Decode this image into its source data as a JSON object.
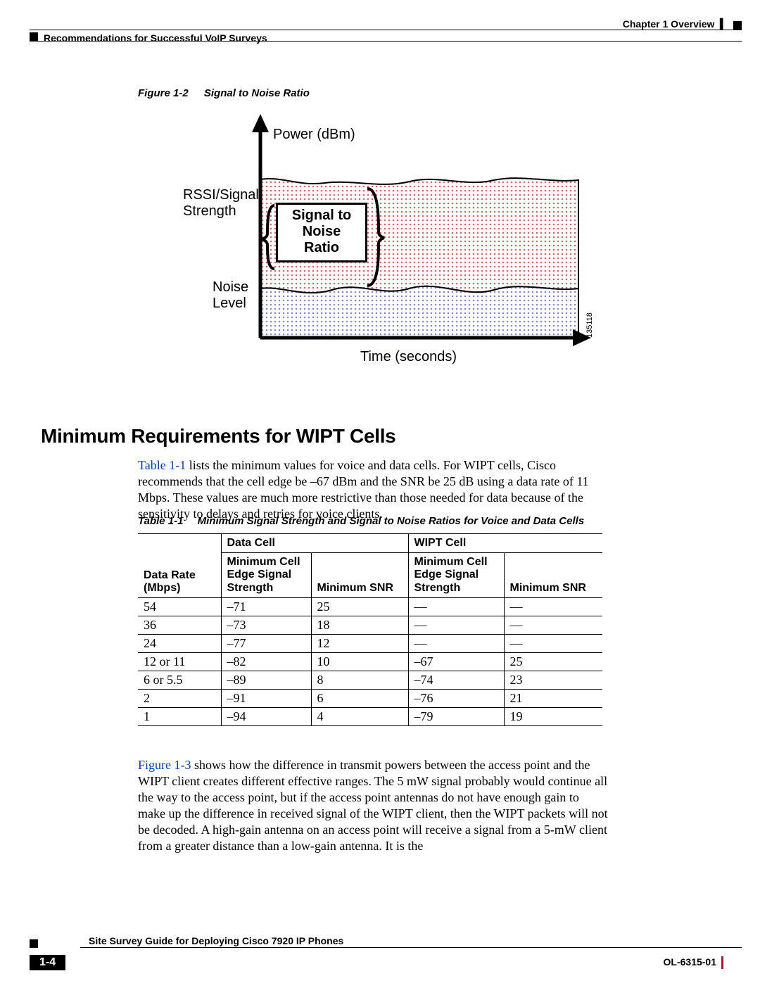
{
  "header": {
    "chapter": "Chapter 1    Overview",
    "section": "Recommendations for Successful VoIP Surveys"
  },
  "figure": {
    "num": "Figure 1-2",
    "title": "Signal to Noise Ratio",
    "labels": {
      "power": "Power (dBm)",
      "rssi_signal": "RSSI/Signal",
      "strength": "Strength",
      "snr1": "Signal to",
      "snr2": "Noise",
      "snr3": "Ratio",
      "noise": "Noise",
      "level": "Level",
      "time": "Time (seconds)",
      "id": "135118"
    }
  },
  "heading": "Minimum Requirements for WIPT Cells",
  "para1_link": "Table 1-1",
  "para1_rest": " lists the minimum values for voice and data cells. For WIPT cells, Cisco recommends that the cell edge be –67 dBm and the SNR be 25 dB using a data rate of 11 Mbps. These values are much more restrictive than those needed for data because of the sensitivity to delays and retries for voice clients.",
  "table_cap": {
    "num": "Table 1-1",
    "title": "Minimum Signal Strength and Signal to Noise Ratios for Voice and Data Cells"
  },
  "table": {
    "groups": {
      "g1": "Data Cell",
      "g2": "WIPT Cell"
    },
    "cols": {
      "c0": "Data Rate (Mbps)",
      "c1a": "Minimum Cell",
      "c1b": "Edge Signal",
      "c1c": "Strength",
      "c2": "Minimum SNR",
      "c3a": "Minimum Cell",
      "c3b": "Edge Signal",
      "c3c": "Strength",
      "c4": "Minimum SNR"
    },
    "rows": [
      {
        "rate": "54",
        "d_edge": "–71",
        "d_snr": "25",
        "w_edge": "—",
        "w_snr": "—"
      },
      {
        "rate": "36",
        "d_edge": "–73",
        "d_snr": "18",
        "w_edge": "—",
        "w_snr": "—"
      },
      {
        "rate": "24",
        "d_edge": "–77",
        "d_snr": "12",
        "w_edge": "—",
        "w_snr": "—"
      },
      {
        "rate": "12 or 11",
        "d_edge": "–82",
        "d_snr": "10",
        "w_edge": "–67",
        "w_snr": "25"
      },
      {
        "rate": "6 or 5.5",
        "d_edge": "–89",
        "d_snr": "8",
        "w_edge": "–74",
        "w_snr": "23"
      },
      {
        "rate": "2",
        "d_edge": "–91",
        "d_snr": "6",
        "w_edge": "–76",
        "w_snr": "21"
      },
      {
        "rate": "1",
        "d_edge": "–94",
        "d_snr": "4",
        "w_edge": "–79",
        "w_snr": "19"
      }
    ]
  },
  "para2_link": "Figure 1-3",
  "para2_rest": " shows how the difference in transmit powers between the access point and the WIPT client creates different effective ranges. The 5 mW signal probably would continue all the way to the access point, but if the access point antennas do not have enough gain to make up the difference in received signal of the WIPT client, then the WIPT packets will not be decoded. A high-gain antenna on an access point will receive a signal from a 5-mW client from a greater distance than a low-gain antenna. It is the",
  "footer": {
    "title": "Site Survey Guide for Deploying Cisco 7920 IP Phones",
    "doc": "OL-6315-01",
    "page": "1-4"
  },
  "chart_data": {
    "type": "table",
    "title": "Minimum Signal Strength and Signal to Noise Ratios for Voice and Data Cells",
    "columns": [
      "Data Rate (Mbps)",
      "Data Cell Minimum Cell Edge Signal Strength",
      "Data Cell Minimum SNR",
      "WIPT Cell Minimum Cell Edge Signal Strength",
      "WIPT Cell Minimum SNR"
    ],
    "rows": [
      [
        "54",
        -71,
        25,
        null,
        null
      ],
      [
        "36",
        -73,
        18,
        null,
        null
      ],
      [
        "24",
        -77,
        12,
        null,
        null
      ],
      [
        "12 or 11",
        -82,
        10,
        -67,
        25
      ],
      [
        "6 or 5.5",
        -89,
        8,
        -74,
        23
      ],
      [
        "2",
        -91,
        6,
        -76,
        21
      ],
      [
        "1",
        -94,
        4,
        -79,
        19
      ]
    ]
  }
}
